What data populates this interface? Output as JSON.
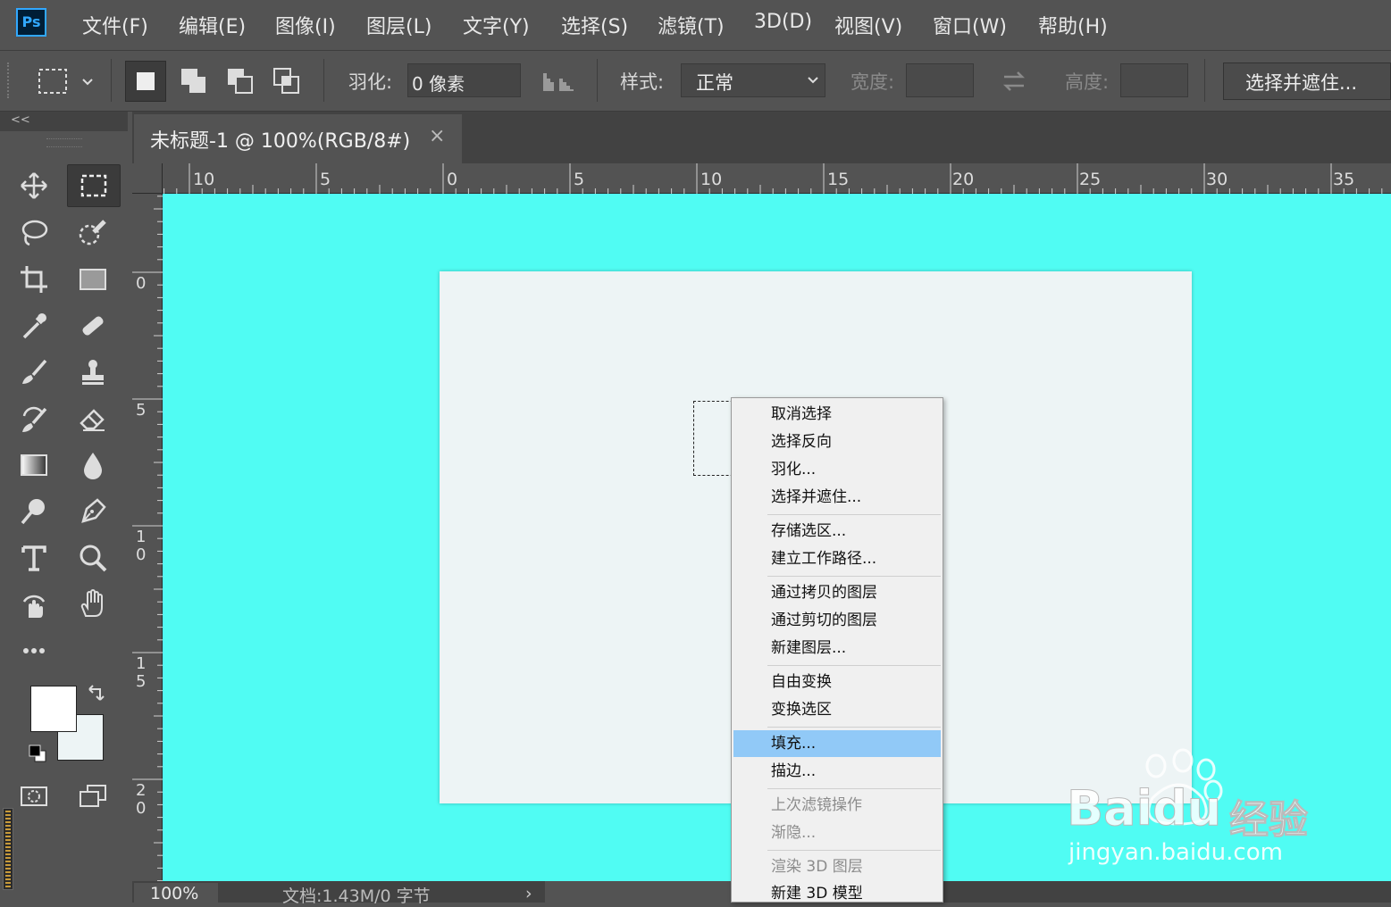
{
  "app": {
    "logo": "Ps"
  },
  "menubar": [
    "文件(F)",
    "编辑(E)",
    "图像(I)",
    "图层(L)",
    "文字(Y)",
    "选择(S)",
    "滤镜(T)",
    "3D(D)",
    "视图(V)",
    "窗口(W)",
    "帮助(H)"
  ],
  "options": {
    "feather_label": "羽化:",
    "feather_value": "0 像素",
    "style_label": "样式:",
    "style_value": "正常",
    "width_label": "宽度:",
    "height_label": "高度:",
    "select_mask_button": "选择并遮住..."
  },
  "panel": {
    "collapse": "<<"
  },
  "document": {
    "tab_title": "未标题-1 @ 100%(RGB/8#)",
    "tab_close": "×",
    "zoom": "100%",
    "doc_info": "文档:1.43M/0 字节",
    "status_arrow": "›"
  },
  "rulers": {
    "h_labels": [
      "10",
      "5",
      "0",
      "5",
      "10",
      "15",
      "20",
      "25",
      "30",
      "35"
    ],
    "v_labels": [
      "0",
      "5",
      "1\n0",
      "1\n5",
      "2\n0"
    ]
  },
  "context_menu": {
    "items": [
      {
        "label": "取消选择"
      },
      {
        "label": "选择反向"
      },
      {
        "label": "羽化..."
      },
      {
        "label": "选择并遮住..."
      },
      {
        "label": "存储选区..."
      },
      {
        "label": "建立工作路径..."
      },
      {
        "label": "通过拷贝的图层"
      },
      {
        "label": "通过剪切的图层"
      },
      {
        "label": "新建图层..."
      },
      {
        "label": "自由变换"
      },
      {
        "label": "变换选区"
      },
      {
        "label": "填充...",
        "highlighted": true
      },
      {
        "label": "描边..."
      },
      {
        "label": "上次滤镜操作",
        "disabled": true
      },
      {
        "label": "渐隐...",
        "disabled": true
      },
      {
        "label": "渲染 3D 图层",
        "disabled": true
      },
      {
        "label": "新建 3D 模型"
      }
    ]
  },
  "watermark": {
    "brand": "Baidu",
    "suffix": "经验",
    "url": "jingyan.baidu.com"
  },
  "colors": {
    "canvas_bg": "#50fcf3",
    "artboard": "#edf4f5",
    "menu_highlight": "#91c9f7",
    "ui_gray": "#535353"
  },
  "icons": [
    "marquee-icon",
    "move-icon",
    "lasso-icon",
    "quick-select-icon",
    "crop-icon",
    "frame-icon",
    "eyedropper-icon",
    "healing-icon",
    "brush-icon",
    "stamp-icon",
    "history-brush-icon",
    "eraser-icon",
    "gradient-icon",
    "blur-icon",
    "dodge-icon",
    "pen-icon",
    "type-icon",
    "zoom-icon",
    "rotate-view-icon",
    "hand-icon",
    "more-icon",
    "swap-colors-icon",
    "default-colors-icon",
    "quick-mask-icon",
    "screen-mode-icon"
  ]
}
